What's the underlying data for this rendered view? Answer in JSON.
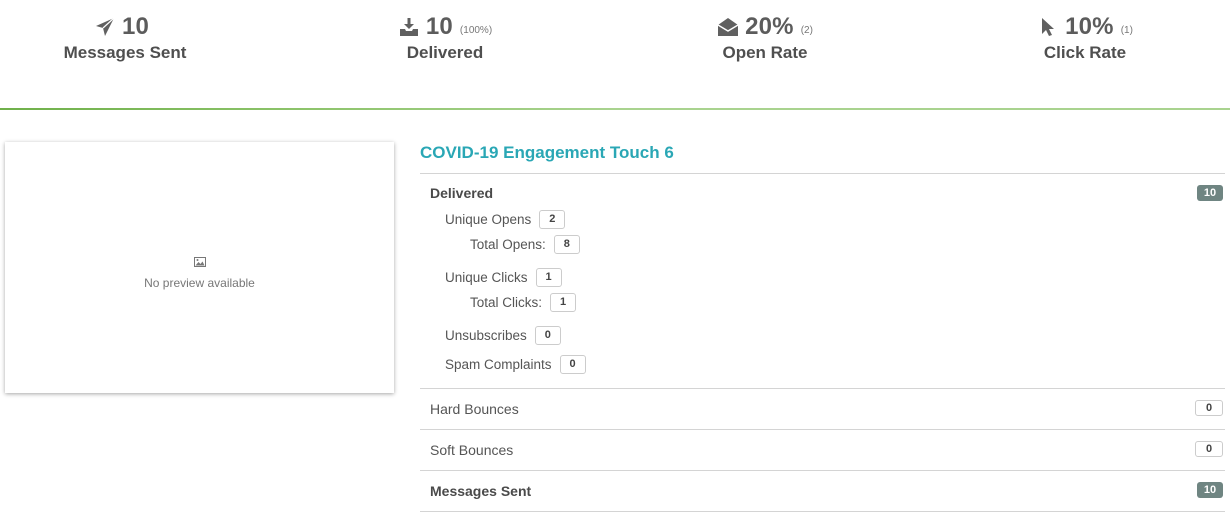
{
  "stats": [
    {
      "icon": "paper-plane-icon",
      "value": "10",
      "sub": "",
      "label": "Messages Sent"
    },
    {
      "icon": "inbox-download-icon",
      "value": "10",
      "sub": "(100%)",
      "label": "Delivered"
    },
    {
      "icon": "envelope-open-icon",
      "value": "20%",
      "sub": "(2)",
      "label": "Open Rate"
    },
    {
      "icon": "cursor-pointer-icon",
      "value": "10%",
      "sub": "(1)",
      "label": "Click Rate"
    }
  ],
  "preview": {
    "icon": "image-icon",
    "text": "No preview available"
  },
  "report": {
    "title": "COVID-19 Engagement Touch 6",
    "delivered": {
      "label": "Delivered",
      "count": "10",
      "unique_opens": {
        "label": "Unique Opens",
        "value": "2"
      },
      "total_opens": {
        "label": "Total Opens:",
        "value": "8"
      },
      "unique_clicks": {
        "label": "Unique Clicks",
        "value": "1"
      },
      "total_clicks": {
        "label": "Total Clicks:",
        "value": "1"
      },
      "unsubscribes": {
        "label": "Unsubscribes",
        "value": "0"
      },
      "spam_complaints": {
        "label": "Spam Complaints",
        "value": "0"
      }
    },
    "hard_bounces": {
      "label": "Hard Bounces",
      "count": "0"
    },
    "soft_bounces": {
      "label": "Soft Bounces",
      "count": "0"
    },
    "messages_sent": {
      "label": "Messages Sent",
      "count": "10"
    }
  },
  "colors": {
    "accent_teal": "#2aa7b5",
    "divider_green": "#8cc36a",
    "badge_dark": "#6f8582",
    "text_gray": "#555555"
  }
}
